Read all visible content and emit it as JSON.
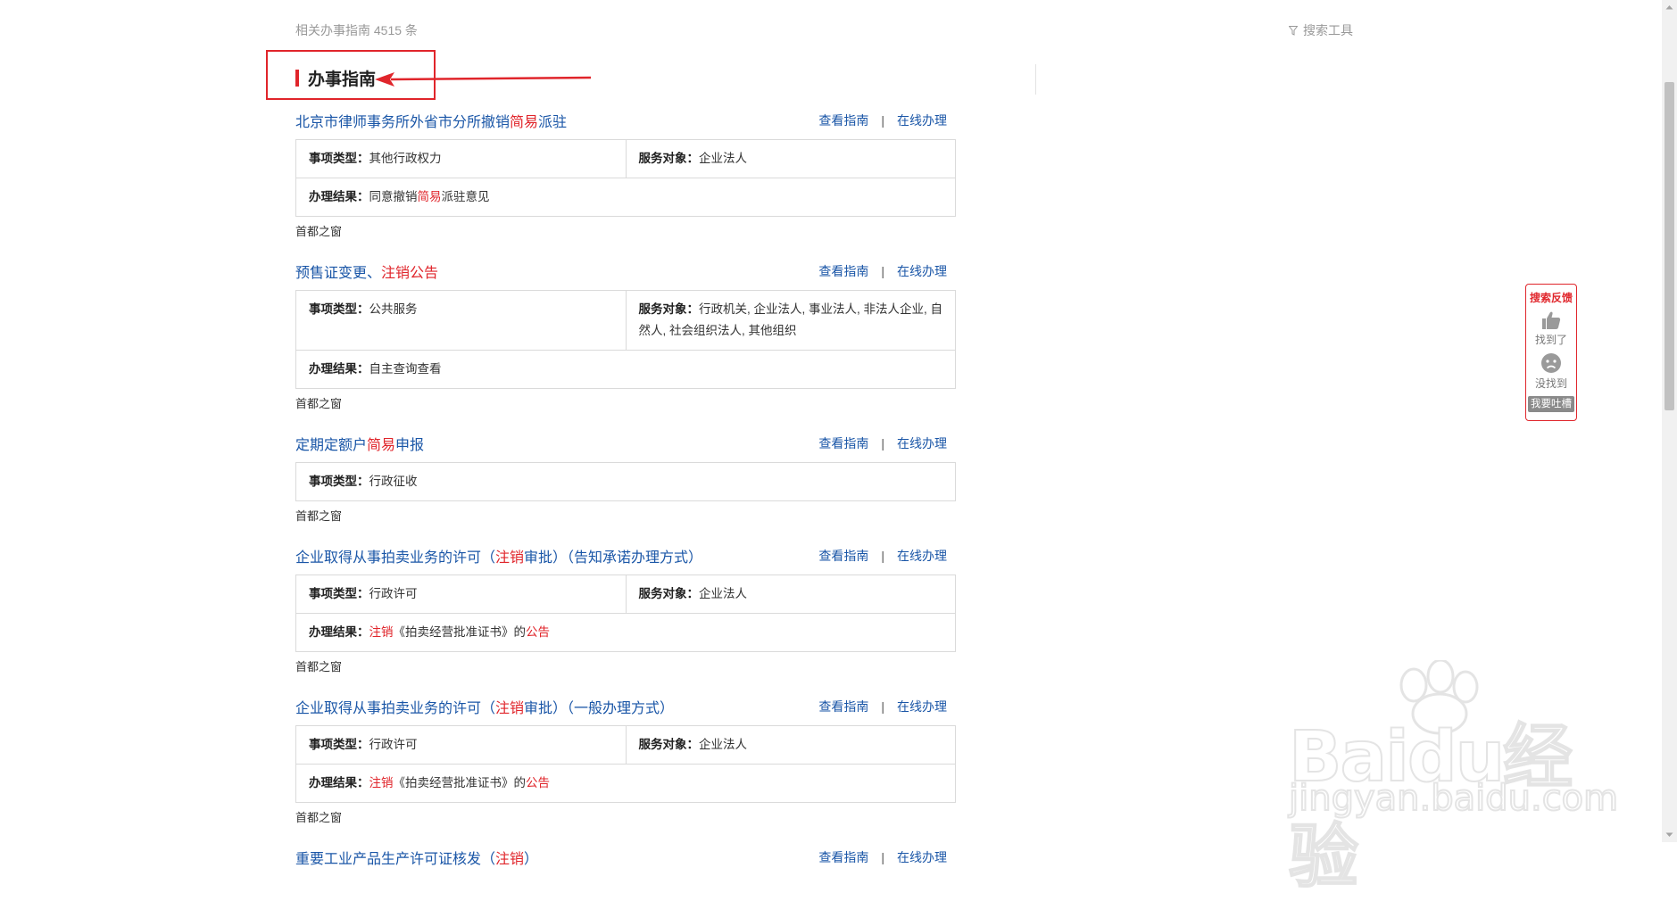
{
  "header": {
    "result_count": "相关办事指南 4515 条",
    "tools_label": "搜索工具"
  },
  "section": {
    "title": "办事指南"
  },
  "labels": {
    "type": "事项类型：",
    "target": "服务对象：",
    "result": "办理结果：",
    "view_guide": "查看指南",
    "separator": "|",
    "online": "在线办理"
  },
  "results": [
    {
      "title_parts": [
        "北京市律师事务所外省市分所撤销",
        "简易",
        "派驻"
      ],
      "type": "其他行政权力",
      "target": "企业法人",
      "result_parts": [
        "同意撤销",
        "简易",
        "派驻意见"
      ],
      "source": "首都之窗"
    },
    {
      "title_parts": [
        "预售证变更、",
        "注销公告",
        ""
      ],
      "type": "公共服务",
      "target": "行政机关, 企业法人, 事业法人, 非法人企业, 自然人, 社会组织法人, 其他组织",
      "result_parts": [
        "自主查询查看",
        "",
        ""
      ],
      "source": "首都之窗"
    },
    {
      "title_parts": [
        "定期定额户",
        "简易",
        "申报"
      ],
      "type": "行政征收",
      "source": "首都之窗"
    },
    {
      "title_parts": [
        "企业取得从事拍卖业务的许可（",
        "注销",
        "审批）（告知承诺办理方式）"
      ],
      "type": "行政许可",
      "target": "企业法人",
      "result_parts": [
        "注销",
        "《拍卖经营批准证书》的",
        "公告"
      ],
      "source": "首都之窗"
    },
    {
      "title_parts": [
        "企业取得从事拍卖业务的许可（",
        "注销",
        "审批）（一般办理方式）"
      ],
      "type": "行政许可",
      "target": "企业法人",
      "result_parts": [
        "注销",
        "《拍卖经营批准证书》的",
        "公告"
      ],
      "source": "首都之窗"
    },
    {
      "title_parts": [
        "重要工业产品生产许可证核发（",
        "注销",
        "）"
      ]
    }
  ],
  "feedback": {
    "title": "搜索反馈",
    "found": "找到了",
    "not_found": "没找到",
    "complain": "我要吐槽"
  },
  "watermark": {
    "brand": "Baidu经验",
    "site": "jingyan.baidu.com"
  },
  "colors": {
    "link": "#1a56a7",
    "highlight": "#e0252b",
    "text": "#333333"
  }
}
